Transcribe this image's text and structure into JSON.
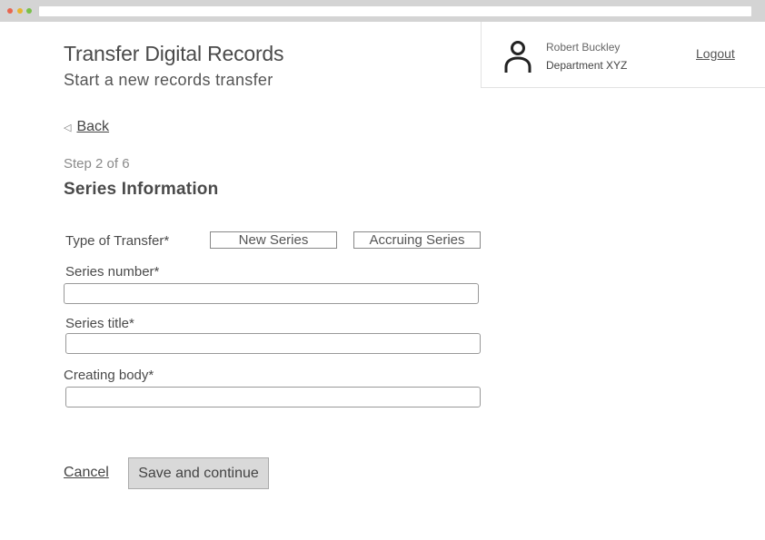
{
  "header": {
    "title": "Transfer Digital Records",
    "subtitle": "Start a new records transfer"
  },
  "user": {
    "name": "Robert Buckley",
    "department": "Department XYZ",
    "logout_label": "Logout",
    "avatar_icon": "user-icon"
  },
  "nav": {
    "back_label": "Back",
    "back_icon": "triangle-left-icon"
  },
  "form": {
    "step": "Step 2 of 6",
    "section_title": "Series Information",
    "transfer_type": {
      "label": "Type of Transfer*",
      "options": [
        "New Series",
        "Accruing Series"
      ]
    },
    "series_number": {
      "label": "Series number*",
      "value": ""
    },
    "series_title": {
      "label": "Series title*",
      "value": ""
    },
    "creating_body": {
      "label": "Creating body*",
      "value": ""
    }
  },
  "actions": {
    "cancel_label": "Cancel",
    "save_label": "Save and continue"
  },
  "colors": {
    "browser_chrome": "#d4d4d4",
    "dot_red": "#e8664f",
    "dot_yellow": "#e6b530",
    "dot_green": "#79c049",
    "button_bg": "#d9d9d9"
  }
}
